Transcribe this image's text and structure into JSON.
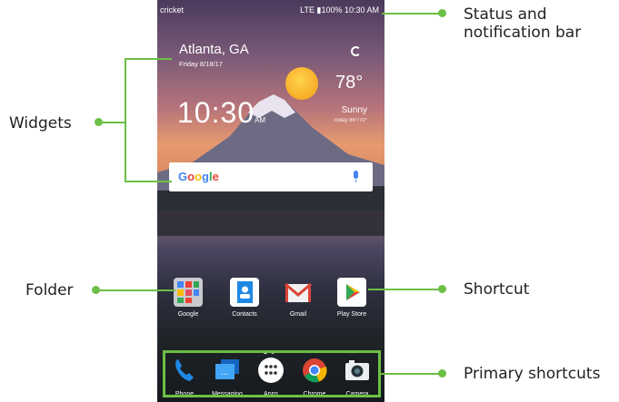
{
  "callouts": {
    "status_line1": "Status and",
    "status_line2": "notification bar",
    "widgets": "Widgets",
    "folder": "Folder",
    "shortcut": "Shortcut",
    "primary": "Primary shortcuts"
  },
  "phone": {
    "carrier": "cricket",
    "status_right": "LTE ▮100% 10:30 AM",
    "city": "Atlanta, GA",
    "date": "Friday 8/18/17",
    "temperature": "78°",
    "clock": "10:30",
    "ampm": "AM",
    "condition": "Sunny",
    "hilo": "Today 86°/70°",
    "search_logo": "Google",
    "home_apps": [
      "Google",
      "Contacts",
      "Gmail",
      "Play Store"
    ],
    "dock_apps": [
      "Phone",
      "Messaging",
      "Apps",
      "Chrome",
      "Camera"
    ]
  },
  "colors": {
    "accent": "#6cbf45"
  }
}
